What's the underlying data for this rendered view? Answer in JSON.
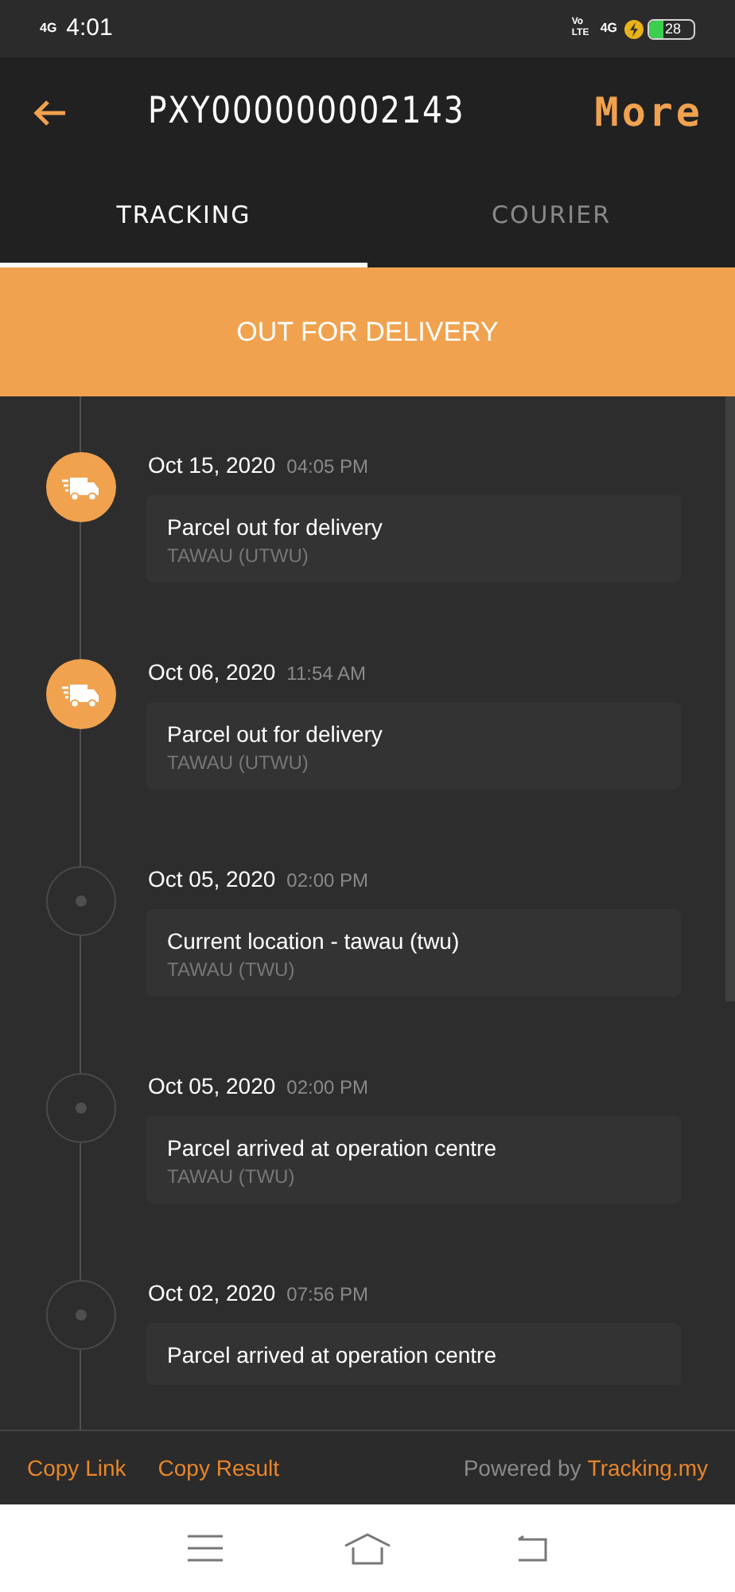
{
  "status_bar": {
    "network": "4G",
    "time": "4:01",
    "volte": "Vo LTE",
    "network_2": "4G",
    "battery": "28"
  },
  "header": {
    "title": "PXY000000002143",
    "action": "More"
  },
  "tabs": [
    {
      "label": "TRACKING",
      "selected": true
    },
    {
      "label": "COURIER",
      "selected": false
    }
  ],
  "banner": "OUT FOR DELIVERY",
  "events": [
    {
      "kind": "delivery",
      "date": "Oct 15, 2020",
      "time": "04:05 PM",
      "description": "Parcel out for delivery",
      "location": "TAWAU (UTWU)"
    },
    {
      "kind": "delivery",
      "date": "Oct 06, 2020",
      "time": "11:54 AM",
      "description": "Parcel out for delivery",
      "location": "TAWAU (UTWU)"
    },
    {
      "kind": "dot",
      "date": "Oct 05, 2020",
      "time": "02:00 PM",
      "description": "Current location - tawau (twu)",
      "location": "TAWAU (TWU)"
    },
    {
      "kind": "dot",
      "date": "Oct 05, 2020",
      "time": "02:00 PM",
      "description": "Parcel arrived at operation centre",
      "location": "TAWAU (TWU)"
    },
    {
      "kind": "dot",
      "date": "Oct 02, 2020",
      "time": "07:56 PM",
      "description": "Parcel arrived at operation centre"
    }
  ],
  "footer": {
    "links": [
      "Copy Link",
      "Copy Result"
    ],
    "powered_by": "Powered by",
    "brand_link": "Tracking.my"
  }
}
